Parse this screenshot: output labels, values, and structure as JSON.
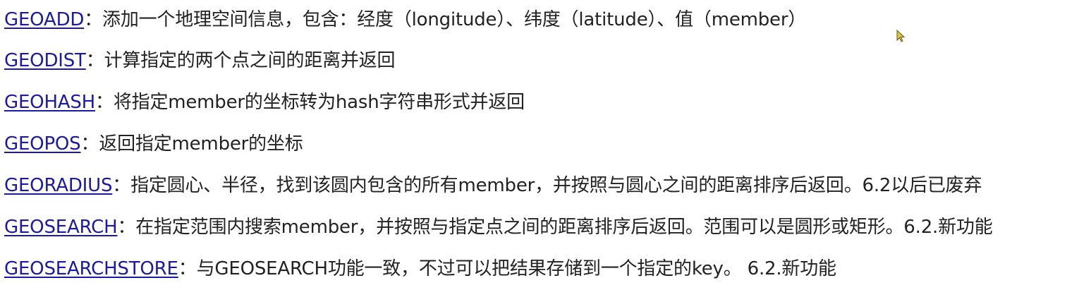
{
  "commands": [
    {
      "name": "GEOADD",
      "sep": "：",
      "desc": "添加一个地理空间信息，包含：经度（longitude）、纬度（latitude）、值（member）"
    },
    {
      "name": "GEODIST",
      "sep": "：",
      "desc": "计算指定的两个点之间的距离并返回"
    },
    {
      "name": "GEOHASH",
      "sep": "：",
      "desc": "将指定member的坐标转为hash字符串形式并返回"
    },
    {
      "name": "GEOPOS",
      "sep": "：",
      "desc": "返回指定member的坐标"
    },
    {
      "name": "GEORADIUS",
      "sep": "：",
      "desc": "指定圆心、半径，找到该圆内包含的所有member，并按照与圆心之间的距离排序后返回。6.2以后已废弃"
    },
    {
      "name": "GEOSEARCH",
      "sep": "：",
      "desc": "在指定范围内搜索member，并按照与指定点之间的距离排序后返回。范围可以是圆形或矩形。6.2.新功能"
    },
    {
      "name": "GEOSEARCHSTORE",
      "sep": "：",
      "desc": "与GEOSEARCH功能一致，不过可以把结果存储到一个指定的key。 6.2.新功能"
    }
  ],
  "colors": {
    "link": "#1a1aa6",
    "text": "#222222",
    "background": "#ffffff"
  },
  "icons": {
    "cursor": "mouse-pointer-icon"
  }
}
